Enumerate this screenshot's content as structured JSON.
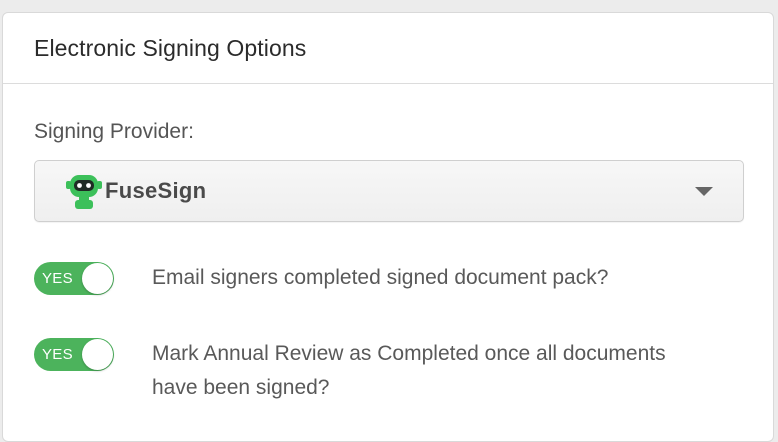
{
  "panel": {
    "title": "Electronic Signing Options"
  },
  "signing_provider": {
    "label": "Signing Provider:",
    "selected": "FuseSign",
    "logo_icon": "fusesign-robot-icon",
    "brand_color": "#3cc05a"
  },
  "options": [
    {
      "toggle_label": "YES",
      "enabled": true,
      "text": "Email signers completed signed document pack?"
    },
    {
      "toggle_label": "YES",
      "enabled": true,
      "text": "Mark Annual Review as Completed once all documents have been signed?"
    }
  ],
  "colors": {
    "toggle_on": "#4cb35c",
    "panel_border": "#d9d9d9"
  }
}
